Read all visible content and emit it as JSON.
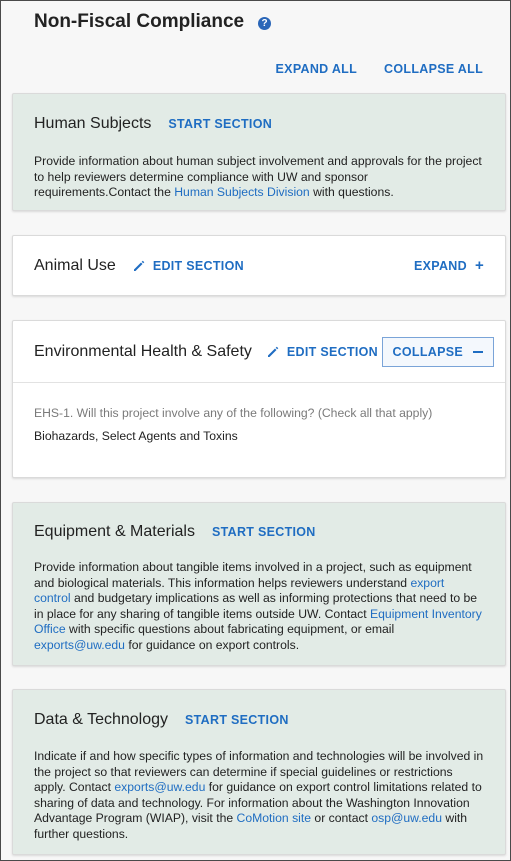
{
  "page": {
    "title": "Non-Fiscal Compliance",
    "help_icon": "question-circle-icon",
    "expand_all": "EXPAND ALL",
    "collapse_all": "COLLAPSE ALL"
  },
  "colors": {
    "accent": "#1f6dc2",
    "tinted_card": "#e2ebe6"
  },
  "sections": {
    "human_subjects": {
      "title": "Human Subjects",
      "action": "START SECTION",
      "desc_1": "Provide information about human subject involvement and approvals for the project to help reviewers determine compliance with UW and sponsor requirements.Contact the ",
      "link_1": "Human Subjects Division",
      "desc_2": " with questions."
    },
    "animal_use": {
      "title": "Animal Use",
      "action": "EDIT SECTION",
      "right": "EXPAND",
      "right_icon": "plus-icon"
    },
    "ehs": {
      "title": "Environmental Health & Safety",
      "action": "EDIT SECTION",
      "right": "COLLAPSE",
      "right_icon": "minus-icon",
      "question": "EHS-1. Will this project involve any of the following? (Check all that apply)",
      "answer": "Biohazards, Select Agents and Toxins"
    },
    "equipment": {
      "title": "Equipment & Materials",
      "action": "START SECTION",
      "desc_1": "Provide information about tangible items involved in a project, such as equipment and biological materials. This information helps reviewers understand ",
      "link_1": "export control",
      "desc_2": " and budgetary implications as well as informing protections that need to be in place for any sharing of tangible items outside UW. Contact ",
      "link_2": "Equipment Inventory Office",
      "desc_3": " with specific questions about fabricating equipment, or email ",
      "link_3": "exports@uw.edu",
      "desc_4": " for guidance on export controls."
    },
    "data_tech": {
      "title": "Data & Technology",
      "action": "START SECTION",
      "desc_1": "Indicate if and how specific types of information and technologies will be involved in the project so that reviewers can determine if special guidelines or restrictions apply. Contact ",
      "link_1": "exports@uw.edu",
      "desc_2": " for guidance on export control limitations related to sharing of data and technology. For information about the Washington Innovation Advantage Program (WIAP), visit the ",
      "link_2": "CoMotion site",
      "desc_3": " or contact ",
      "link_3": "osp@uw.edu",
      "desc_4": " with further questions."
    }
  }
}
